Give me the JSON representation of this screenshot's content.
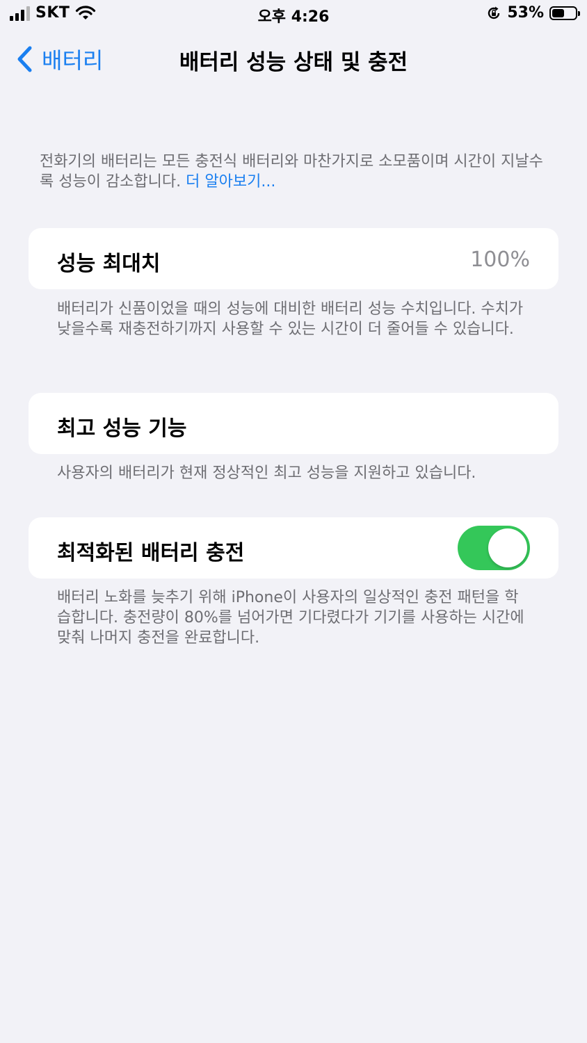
{
  "status_bar": {
    "carrier": "SKT",
    "time": "오후 4:26",
    "battery_percent": "53%",
    "battery_level": 0.53,
    "icons": [
      "signal-bars-icon",
      "wifi-icon",
      "orientation-lock-icon",
      "battery-icon"
    ]
  },
  "nav": {
    "back_label": "배터리",
    "title": "배터리 성능 상태 및 충전"
  },
  "intro": {
    "text": "전화기의 배터리는 모든 충전식 배터리와 마찬가지로 소모품이며 시간이 지날수록 성능이 감소합니다. ",
    "link": "더 알아보기..."
  },
  "max_capacity": {
    "label": "성능 최대치",
    "value": "100%",
    "footer": "배터리가 신품이었을 때의 성능에 대비한 배터리 성능 수치입니다. 수치가 낮을수록 재충전하기까지 사용할 수 있는 시간이 더 줄어들 수 있습니다."
  },
  "peak_performance": {
    "label": "최고 성능 기능",
    "footer": "사용자의 배터리가 현재 정상적인 최고 성능을 지원하고 있습니다."
  },
  "optimized_charging": {
    "label": "최적화된 배터리 충전",
    "enabled": true,
    "footer": "배터리 노화를 늦추기 위해 iPhone이 사용자의 일상적인 충전 패턴을 학습합니다. 충전량이 80%를 넘어가면 기다렸다가 기기를 사용하는 시간에 맞춰 나머지 충전을 완료합니다."
  },
  "colors": {
    "accent": "#1a7ff0",
    "toggle_on": "#34c759",
    "background": "#f2f2f7",
    "secondary_text": "#6d6d72"
  }
}
